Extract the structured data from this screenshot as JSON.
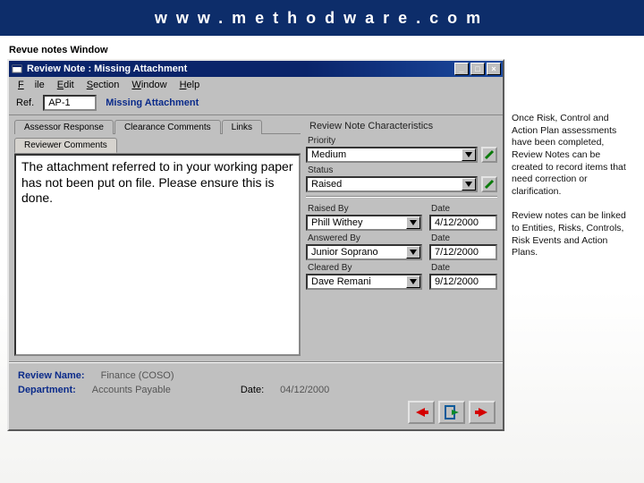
{
  "header": {
    "site": "www.methodware.com"
  },
  "subtitle": "Revue notes Window",
  "window": {
    "title": "Review Note : Missing Attachment",
    "menu": {
      "file": "File",
      "edit": "Edit",
      "section": "Section",
      "window": "Window",
      "help": "Help"
    },
    "ref_label": "Ref.",
    "ref_value": "AP-1",
    "missing_label": "Missing Attachment",
    "tabs_top": {
      "assessor": "Assessor Response",
      "clearance": "Clearance Comments",
      "links": "Links"
    },
    "tabs_mid": {
      "reviewer": "Reviewer Comments"
    },
    "textpane": "The attachment referred to in your working paper has not been put on file. Please ensure this is done.",
    "characteristics": {
      "heading": "Review Note Characteristics",
      "priority_label": "Priority",
      "priority": "Medium",
      "status_label": "Status",
      "status": "Raised",
      "raised_by_label": "Raised By",
      "raised_by": "Phill Withey",
      "raised_date_label": "Date",
      "raised_date": "4/12/2000",
      "answered_by_label": "Answered By",
      "answered_by": "Junior Soprano",
      "answered_date_label": "Date",
      "answered_date": "7/12/2000",
      "cleared_by_label": "Cleared By",
      "cleared_by": "Dave Remani",
      "cleared_date_label": "Date",
      "cleared_date": "9/12/2000"
    },
    "footer": {
      "review_label": "Review Name:",
      "review_value": "Finance (COSO)",
      "dept_label": "Department:",
      "dept_value": "Accounts Payable",
      "date_label": "Date:",
      "date_value": "04/12/2000"
    }
  },
  "side": {
    "p1": "Once Risk, Control and Action Plan assessments have been completed, Review Notes can be created to record items that need correction or clarification.",
    "p2": "Review notes can be linked to Entities, Risks, Controls, Risk Events and Action Plans."
  },
  "icons": {
    "app": "app-icon",
    "min": "_",
    "max": "□",
    "close": "×",
    "arrow_down": "▼",
    "pencil": "✎",
    "prev": "⬅",
    "next": "➡",
    "exit": "exit"
  }
}
